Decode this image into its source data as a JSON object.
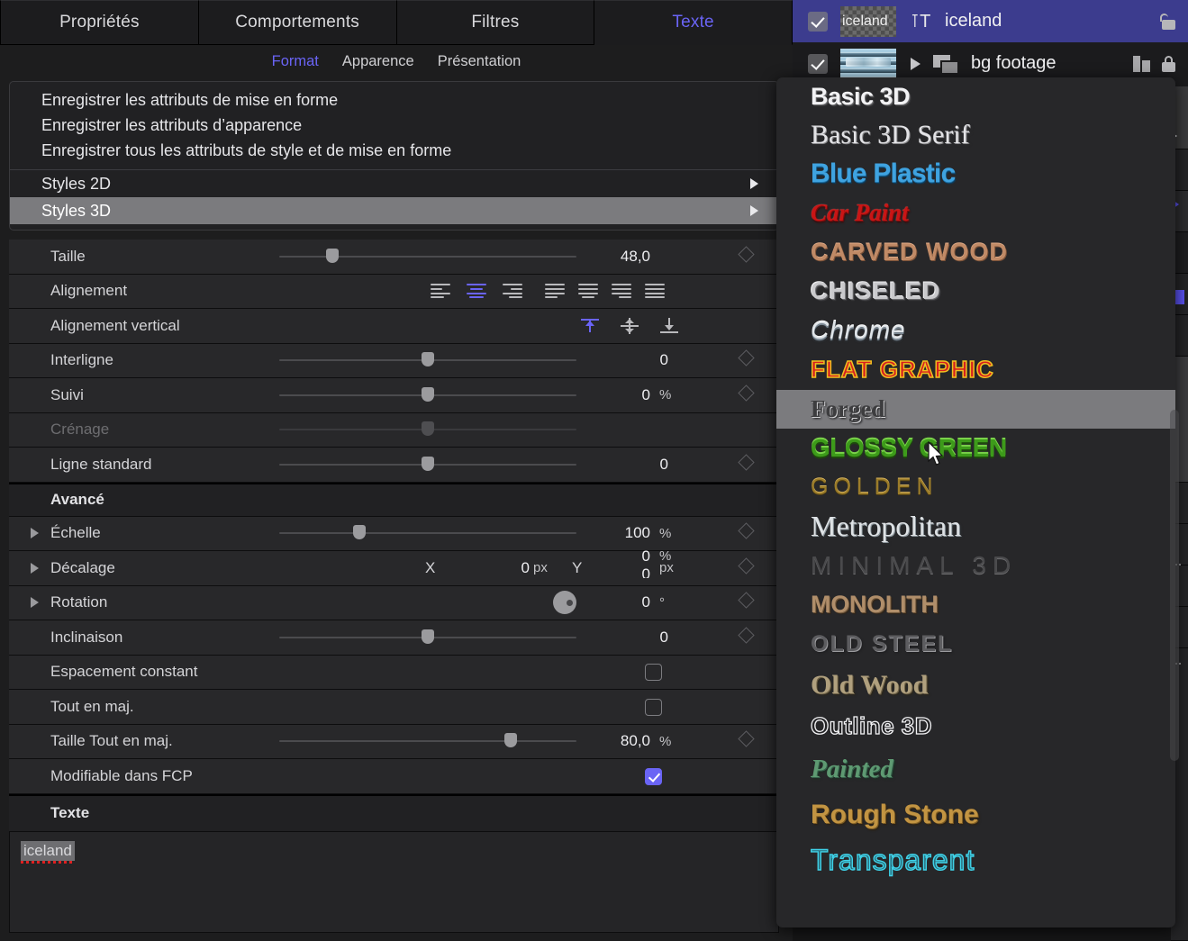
{
  "inspector": {
    "tabs": [
      {
        "label": "Propriétés",
        "active": false
      },
      {
        "label": "Comportements",
        "active": false
      },
      {
        "label": "Filtres",
        "active": false
      },
      {
        "label": "Texte",
        "active": true
      }
    ],
    "subtabs": [
      {
        "label": "Format",
        "active": true
      },
      {
        "label": "Apparence",
        "active": false
      },
      {
        "label": "Présentation",
        "active": false
      }
    ]
  },
  "menu": {
    "items": [
      "Enregistrer les attributs de mise en forme",
      "Enregistrer les attributs d’apparence",
      "Enregistrer tous les attributs de style et de mise en forme"
    ],
    "submenus": [
      {
        "label": "Styles 2D",
        "highlighted": false
      },
      {
        "label": "Styles 3D",
        "highlighted": true
      }
    ]
  },
  "params": [
    {
      "label": "Taille",
      "value": "48,0",
      "unit": "",
      "knob": 18
    },
    {
      "label": "Alignement"
    },
    {
      "label": "Alignement vertical"
    },
    {
      "label": "Interligne",
      "value": "0",
      "unit": "",
      "knob": 50
    },
    {
      "label": "Suivi",
      "value": "0",
      "unit": "%",
      "knob": 50
    },
    {
      "label": "Crénage",
      "value": "",
      "unit": "",
      "knob": 50,
      "disabled": true
    },
    {
      "label": "Ligne standard",
      "value": "0",
      "unit": "",
      "knob": 50
    }
  ],
  "advanced": {
    "header": "Avancé",
    "rows": [
      {
        "label": "Échelle",
        "value": "100",
        "unit": "%",
        "knob": 27,
        "disclosure": true,
        "overlap_value": "0",
        "overlap_unit": "%"
      },
      {
        "label": "Décalage",
        "x_label": "X",
        "x_value": "0",
        "x_unit": "px",
        "y_label": "Y",
        "y_value": "0",
        "y_unit": "px",
        "disclosure": true
      },
      {
        "label": "Rotation",
        "value": "0",
        "unit": "°",
        "disclosure": true,
        "dial": true
      },
      {
        "label": "Inclinaison",
        "value": "0",
        "unit": "",
        "knob": 50
      },
      {
        "label": "Espacement constant",
        "checkbox": false
      },
      {
        "label": "Tout en maj.",
        "checkbox": false
      },
      {
        "label": "Taille Tout en maj.",
        "value": "80,0",
        "unit": "%",
        "knob": 78
      },
      {
        "label": "Modifiable dans FCP",
        "checkbox": true
      }
    ]
  },
  "text_group": {
    "header": "Texte",
    "value": "iceland"
  },
  "layers": [
    {
      "name": "iceland",
      "checked": true,
      "selected": true,
      "thumb_label": "iceland",
      "type_icon": "text-tool-icon",
      "lock_state": "unlocked"
    },
    {
      "name": "bg footage",
      "checked": true,
      "selected": false,
      "thumb_label": "",
      "type_icon": "group-icon",
      "lock_state": "locked"
    }
  ],
  "styles_popup": {
    "items": [
      {
        "label": "Basic 3D",
        "class": "s-basic3d"
      },
      {
        "label": "Basic 3D Serif",
        "class": "s-serif"
      },
      {
        "label": "Blue Plastic",
        "class": "s-blue"
      },
      {
        "label": "Car Paint",
        "class": "s-carpaint"
      },
      {
        "label": "CARVED WOOD",
        "class": "s-carved"
      },
      {
        "label": "CHISELED",
        "class": "s-chisel"
      },
      {
        "label": "Chrome",
        "class": "s-chrome"
      },
      {
        "label": "FLAT GRAPHIC",
        "class": "s-flat"
      },
      {
        "label": "Forged",
        "class": "s-forged",
        "highlighted": true
      },
      {
        "label": "GLOSSY GREEN",
        "class": "s-glossy"
      },
      {
        "label": "GOLDEN",
        "class": "s-golden"
      },
      {
        "label": "Metropolitan",
        "class": "s-metro"
      },
      {
        "label": "MINIMAL 3D",
        "class": "s-minimal"
      },
      {
        "label": "MONOLITH",
        "class": "s-mono"
      },
      {
        "label": "OLD STEEL",
        "class": "s-oldsteel"
      },
      {
        "label": "Old Wood",
        "class": "s-oldwood"
      },
      {
        "label": "Outline 3D",
        "class": "s-outline"
      },
      {
        "label": "Painted",
        "class": "s-painted"
      },
      {
        "label": "Rough Stone",
        "class": "s-rough"
      },
      {
        "label": "Transparent",
        "class": "s-transp"
      }
    ]
  },
  "colors": {
    "accent": "#6a64f5",
    "panel_bg": "#1d1d1e",
    "row_bg": "#28282a",
    "popup_bg": "#272729",
    "highlight": "#7b7b7e",
    "layer_selected": "#3c3c8e"
  }
}
